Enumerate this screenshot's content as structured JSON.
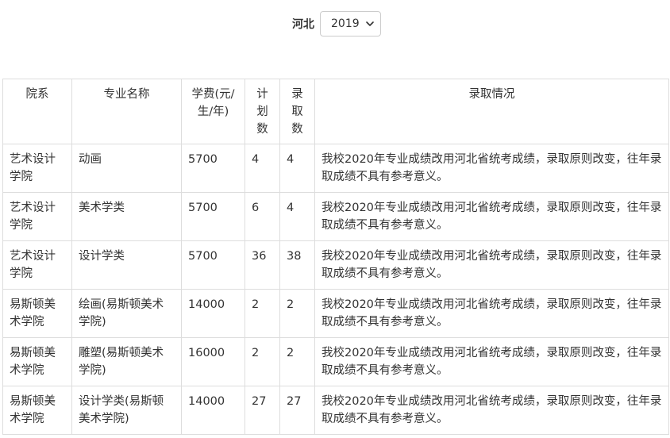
{
  "filter": {
    "province_label": "河北",
    "year_selected": "2019"
  },
  "table": {
    "headers": [
      "院系",
      "专业名称",
      "学费(元/生/年)",
      "计划数",
      "录取数",
      "录取情况"
    ],
    "rows": [
      {
        "dept": "艺术设计学院",
        "major": "动画",
        "fee": "5700",
        "plan": "4",
        "admitted": "4",
        "status": "我校2020年专业成绩改用河北省统考成绩，录取原则改变，往年录取成绩不具有参考意义。"
      },
      {
        "dept": "艺术设计学院",
        "major": "美术学类",
        "fee": "5700",
        "plan": "6",
        "admitted": "4",
        "status": "我校2020年专业成绩改用河北省统考成绩，录取原则改变，往年录取成绩不具有参考意义。"
      },
      {
        "dept": "艺术设计学院",
        "major": "设计学类",
        "fee": "5700",
        "plan": "36",
        "admitted": "38",
        "status": "我校2020年专业成绩改用河北省统考成绩，录取原则改变，往年录取成绩不具有参考意义。"
      },
      {
        "dept": "易斯顿美术学院",
        "major": "绘画(易斯顿美术学院)",
        "fee": "14000",
        "plan": "2",
        "admitted": "2",
        "status": "我校2020年专业成绩改用河北省统考成绩，录取原则改变，往年录取成绩不具有参考意义。"
      },
      {
        "dept": "易斯顿美术学院",
        "major": "雕塑(易斯顿美术学院)",
        "fee": "16000",
        "plan": "2",
        "admitted": "2",
        "status": "我校2020年专业成绩改用河北省统考成绩，录取原则改变，往年录取成绩不具有参考意义。"
      },
      {
        "dept": "易斯顿美术学院",
        "major": "设计学类(易斯顿美术学院)",
        "fee": "14000",
        "plan": "27",
        "admitted": "27",
        "status": "我校2020年专业成绩改用河北省统考成绩，录取原则改变，往年录取成绩不具有参考意义。"
      }
    ]
  }
}
